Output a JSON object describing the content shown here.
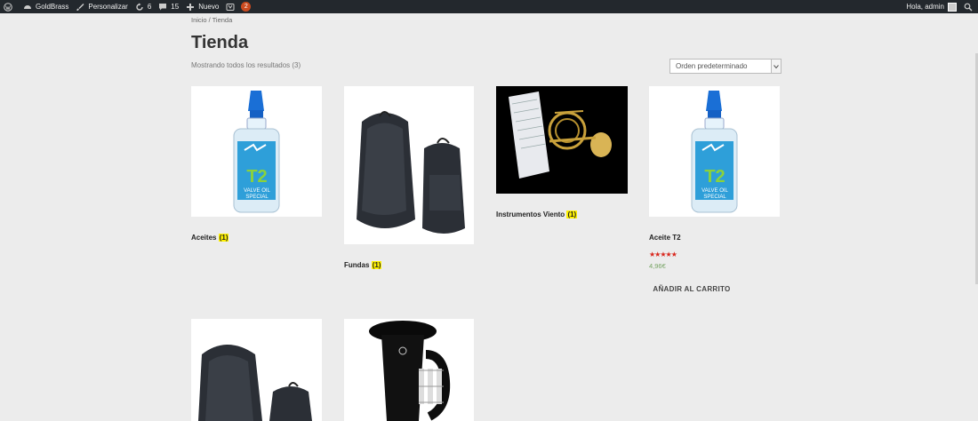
{
  "adminbar": {
    "site_name": "GoldBrass",
    "customize": "Personalizar",
    "updates_count": "6",
    "comments_count": "15",
    "new_label": "Nuevo",
    "yoast_badge": "2",
    "greeting": "Hola, admin"
  },
  "breadcrumb": "Inicio / Tienda",
  "page_title": "Tienda",
  "result_count": "Mostrando todos los resultados (3)",
  "orderby_selected": "Orden predeterminado",
  "categories": [
    {
      "name": "Aceites",
      "count": "(1)"
    },
    {
      "name": "Fundas",
      "count": "(1)"
    },
    {
      "name": "Instrumentos Viento",
      "count": "(1)"
    }
  ],
  "product": {
    "name": "Aceite T2",
    "rating_stars": "★★★★★",
    "price": "4,96€",
    "add_to_cart": "AÑADIR AL CARRITO"
  },
  "colors": {
    "adminbar_bg": "#23282d",
    "badge": "#ca4a1f",
    "count_highlight": "#fff200",
    "stars": "#d9261c",
    "price": "#77a464"
  }
}
